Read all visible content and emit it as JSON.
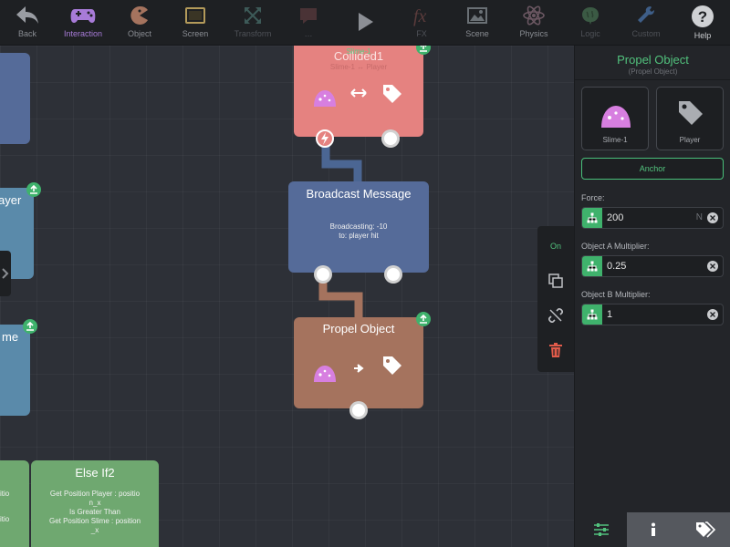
{
  "toolbar": {
    "items": [
      {
        "label": "Back",
        "icon": "back-arrow-icon"
      },
      {
        "label": "Interaction",
        "icon": "gamepad-icon"
      },
      {
        "label": "Object",
        "icon": "pacman-icon"
      },
      {
        "label": "Screen",
        "icon": "screen-icon"
      },
      {
        "label": "Transform",
        "icon": "transform-icon"
      },
      {
        "label": "…",
        "icon": "comment-icon"
      },
      {
        "label": "",
        "icon": "play-icon"
      },
      {
        "label": "FX",
        "icon": "fx-icon"
      },
      {
        "label": "Scene",
        "icon": "scene-icon"
      },
      {
        "label": "Physics",
        "icon": "atom-icon"
      },
      {
        "label": "Logic",
        "icon": "brain-icon"
      },
      {
        "label": "Custom",
        "icon": "wrench-icon"
      },
      {
        "label": "Help",
        "icon": "help-icon"
      }
    ]
  },
  "canvas": {
    "collided_node": {
      "title": "Collided1",
      "overlay": "Slime-1",
      "subtitle": "Slime-1 ↔ Player"
    },
    "broadcast_node": {
      "title": "Broadcast Message",
      "line1": "Broadcasting: -10",
      "line2": "to: player hit"
    },
    "propel_node": {
      "title": "Propel Object"
    },
    "left_player_node": {
      "title_fragment": "ayer"
    },
    "left_slime_node": {
      "title_fragment": "me"
    },
    "left_bottom_node": {
      "lines": [
        "itio",
        "",
        "itio"
      ]
    },
    "else_node": {
      "title": "Else If2",
      "line1": "Get Position Player : positio",
      "line2": "n_x",
      "line3": "Is Greater Than",
      "line4": "Get Position Slime : position",
      "line5": "_x"
    }
  },
  "float_menu": {
    "on_label": "On"
  },
  "panel": {
    "title": "Propel Object",
    "subtitle": "(Propel Object)",
    "object_a_label": "Slime-1",
    "object_b_label": "Player",
    "anchor_label": "Anchor",
    "force": {
      "label": "Force:",
      "value": "200",
      "unit": "N"
    },
    "mult_a": {
      "label": "Object A Multiplier:",
      "value": "0.25"
    },
    "mult_b": {
      "label": "Object B Multiplier:",
      "value": "1"
    }
  },
  "colors": {
    "accent_green": "#3fb26c",
    "collided_node": "#e58280",
    "broadcast_node": "#556b99",
    "propel_node": "#a5735e",
    "left_node_blue": "#5a8aaa",
    "else_node": "#6fa870",
    "slime": "#d77fe0"
  }
}
